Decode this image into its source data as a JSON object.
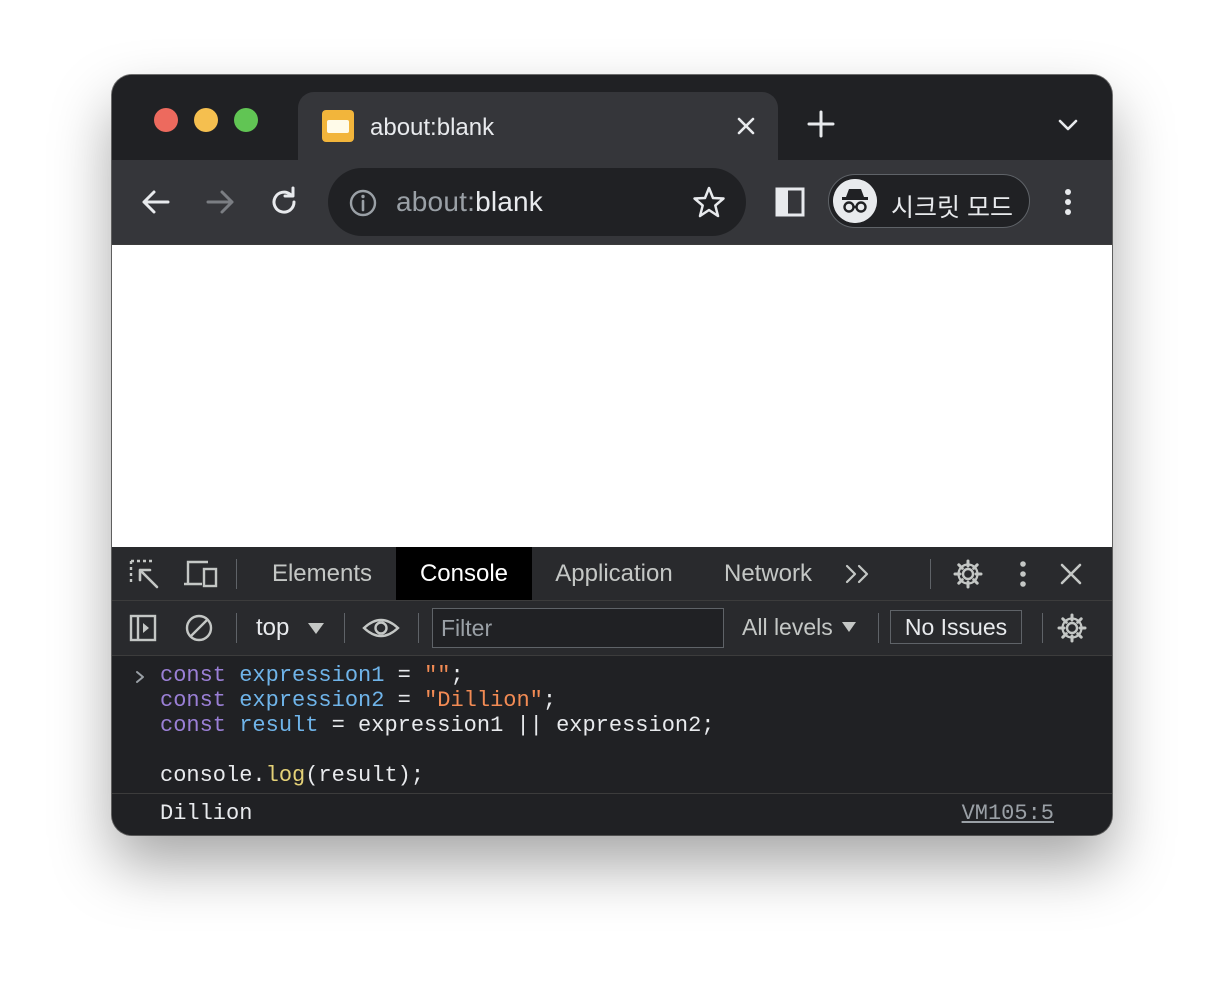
{
  "tab": {
    "title": "about:blank"
  },
  "omnibox": {
    "url_prefix": "about:",
    "url_main": "blank"
  },
  "profile": {
    "incognito_label": "시크릿 모드"
  },
  "devtools": {
    "tabs": [
      "Elements",
      "Console",
      "Application",
      "Network"
    ],
    "active_tab": "Console",
    "console_toolbar": {
      "context": "top",
      "filter_placeholder": "Filter",
      "levels": "All levels",
      "issues": "No Issues"
    },
    "console": {
      "input_lines": [
        "const expression1 = \"\";",
        "const expression2 = \"Dillion\";",
        "const result = expression1 || expression2;",
        "",
        "console.log(result);"
      ],
      "output": "Dillion",
      "source": "VM105:5"
    }
  },
  "colors": {
    "chrome_dark": "#202124",
    "toolbar": "#35363a",
    "keyword": "#9a7fd5",
    "variable": "#6fb4e9",
    "string": "#f28b54",
    "function": "#e4d177"
  }
}
